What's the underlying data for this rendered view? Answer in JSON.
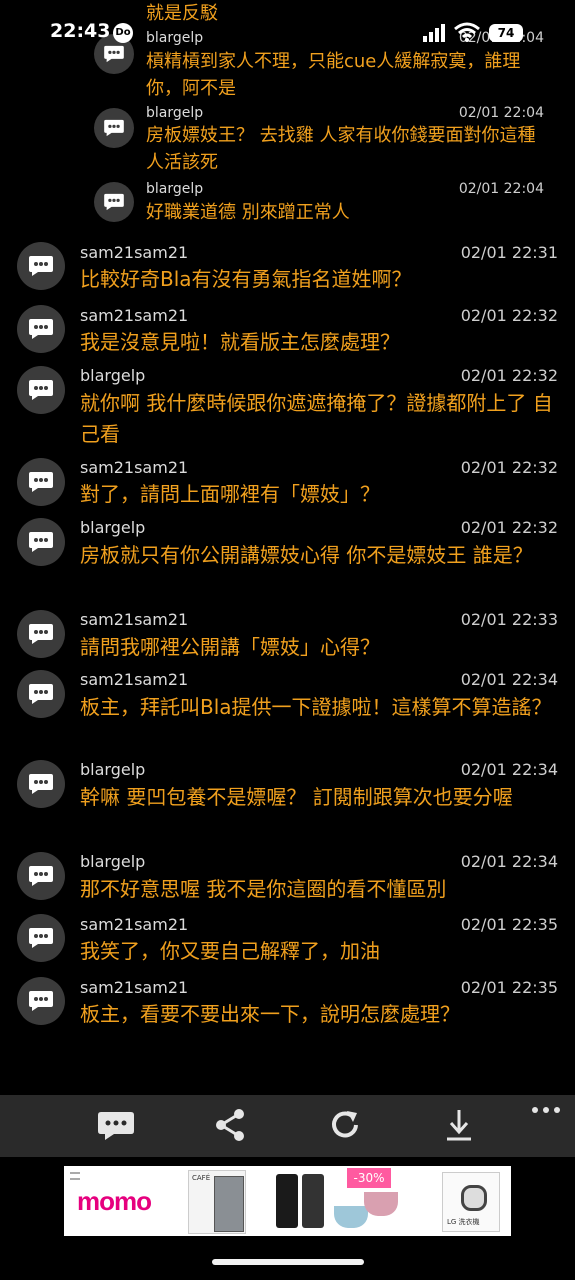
{
  "status": {
    "time": "22:43",
    "app_badge": "Do",
    "battery": "74"
  },
  "nested": [
    {
      "text": "就是反駁"
    },
    {
      "user": "blargelp",
      "time": "02/01 22:04",
      "text": "槓精槓到家人不理，只能cue人緩解寂寞，誰理你，阿不是"
    },
    {
      "user": "blargelp",
      "time": "02/01 22:04",
      "text": "房板嫖妓王？ 去找雞 人家有收你錢要面對你這種人活該死"
    },
    {
      "user": "blargelp",
      "time": "02/01 22:04",
      "text": "好職業道德 別來蹭正常人"
    }
  ],
  "messages": [
    {
      "user": "sam21sam21",
      "time": "02/01 22:31",
      "text": "比較好奇Bla有沒有勇氣指名道姓啊？"
    },
    {
      "user": "sam21sam21",
      "time": "02/01 22:32",
      "text": "我是沒意見啦！就看版主怎麼處理？"
    },
    {
      "user": "blargelp",
      "time": "02/01 22:32",
      "text": "就你啊 我什麼時候跟你遮遮掩掩了？證據都附上了 自己看"
    },
    {
      "user": "sam21sam21",
      "time": "02/01 22:32",
      "text": "對了，請問上面哪裡有「嫖妓」？"
    },
    {
      "user": "blargelp",
      "time": "02/01 22:32",
      "text": "房板就只有你公開講嫖妓心得 你不是嫖妓王 誰是？"
    },
    {
      "user": "sam21sam21",
      "time": "02/01 22:33",
      "text": "請問我哪裡公開講「嫖妓」心得？"
    },
    {
      "user": "sam21sam21",
      "time": "02/01 22:34",
      "text": "板主，拜託叫Bla提供一下證據啦！這樣算不算造謠？"
    },
    {
      "user": "blargelp",
      "time": "02/01 22:34",
      "text": "幹嘛 要凹包養不是嫖喔？ 訂閱制跟算次也要分喔"
    },
    {
      "user": "blargelp",
      "time": "02/01 22:34",
      "text": "那不好意思喔 我不是你這圈的看不懂區別"
    },
    {
      "user": "sam21sam21",
      "time": "02/01 22:35",
      "text": "我笑了，你又要自己解釋了，加油"
    },
    {
      "user": "sam21sam21",
      "time": "02/01 22:35",
      "text": "板主，看要不要出來一下，說明怎麼處理？"
    }
  ],
  "toolbar": {
    "icons": [
      "comment-icon",
      "share-icon",
      "refresh-icon",
      "download-icon",
      "more-icon"
    ]
  },
  "ad": {
    "brand": "momo",
    "cafe_label": "CAFÉ",
    "discount": "-30%",
    "lg_label": "LG 洗衣機"
  },
  "colors": {
    "message_text": "#f0a01e",
    "background": "#000000",
    "toolbar": "#2a2a2a"
  }
}
